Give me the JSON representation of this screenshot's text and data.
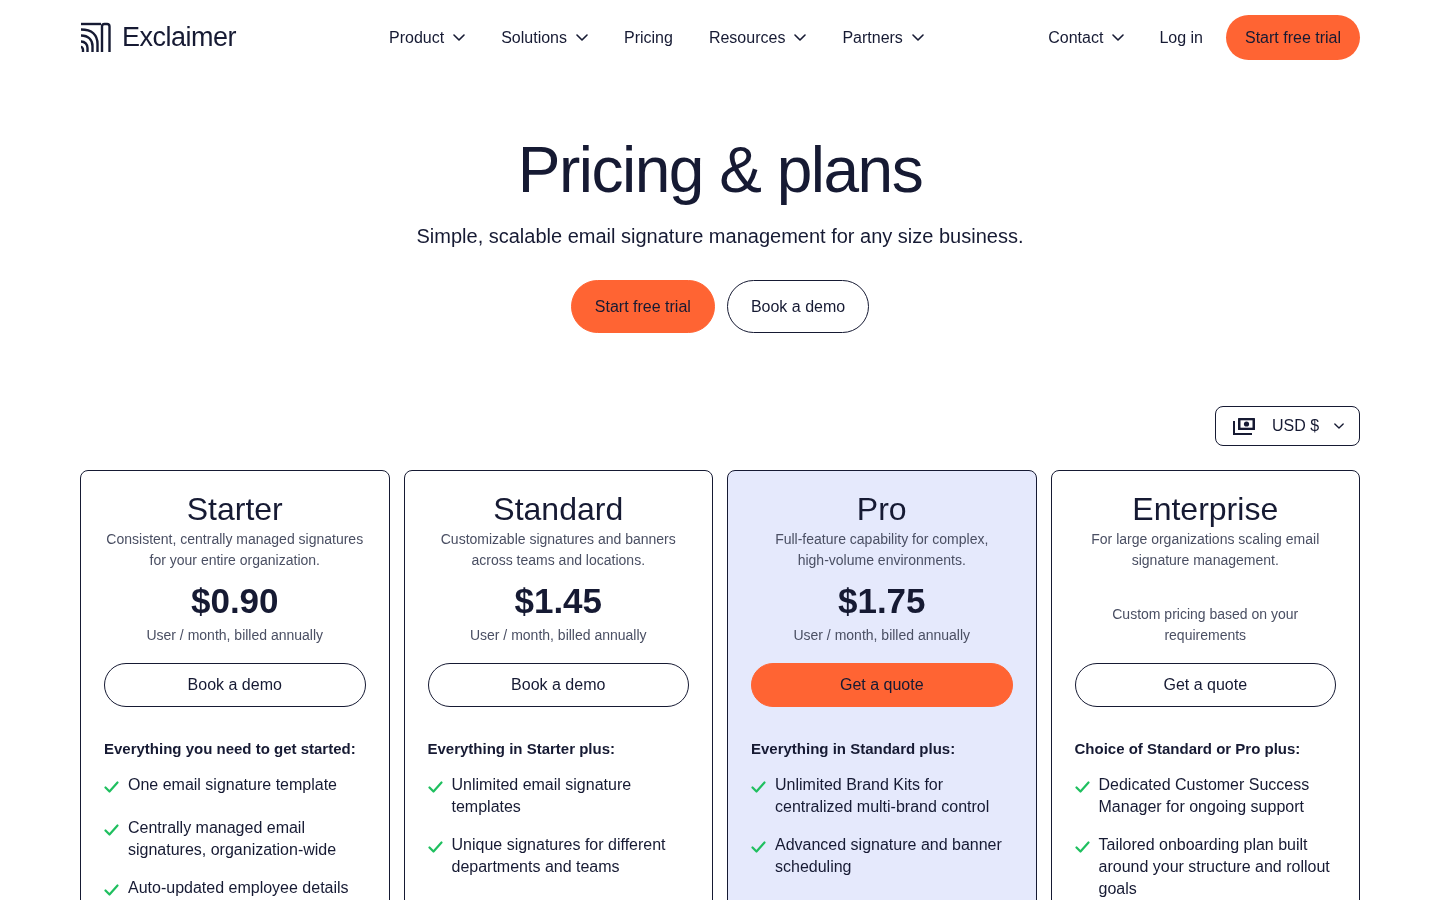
{
  "header": {
    "logo": {
      "text": "Exclaimer"
    },
    "nav": [
      {
        "label": "Product",
        "dropdown": true
      },
      {
        "label": "Solutions",
        "dropdown": true
      },
      {
        "label": "Pricing",
        "dropdown": false
      },
      {
        "label": "Resources",
        "dropdown": true
      },
      {
        "label": "Partners",
        "dropdown": true
      }
    ],
    "secondary_nav": [
      {
        "label": "Contact",
        "dropdown": true
      },
      {
        "label": "Log in",
        "dropdown": false
      }
    ],
    "cta": {
      "label": "Start free trial"
    }
  },
  "hero": {
    "title": "Pricing & plans",
    "subtitle": "Simple, scalable email signature management for any size business.",
    "buttons": [
      {
        "label": "Start free trial",
        "kind": "primary"
      },
      {
        "label": "Book a demo",
        "kind": "outline"
      }
    ]
  },
  "currency": {
    "label": "USD $"
  },
  "plans": [
    {
      "name": "Starter",
      "description": [
        "Consistent, centrally managed signatures",
        "for your entire organization."
      ],
      "featured": false,
      "price": "$0.90",
      "billing": "User / month, billed annually",
      "button": {
        "label": "Book a demo"
      },
      "features_heading": "Everything you need to get started:",
      "features": [
        "One email signature template",
        "Centrally managed email signatures, organization-wide",
        "Auto-updated employee details"
      ]
    },
    {
      "name": "Standard",
      "description": [
        "Customizable signatures and banners",
        "across teams and locations."
      ],
      "featured": false,
      "price": "$1.45",
      "billing": "User / month, billed annually",
      "button": {
        "label": "Book a demo"
      },
      "features_heading": "Everything in Starter plus:",
      "features": [
        "Unlimited email signature templates",
        "Unique signatures for different departments and teams"
      ]
    },
    {
      "name": "Pro",
      "description": [
        "Full-feature capability for complex,",
        "high-volume environments."
      ],
      "featured": true,
      "price": "$1.75",
      "billing": "User / month, billed annually",
      "button": {
        "label": "Get a quote"
      },
      "features_heading": "Everything in Standard plus:",
      "features": [
        "Unlimited Brand Kits for centralized multi-brand control",
        "Advanced signature and banner scheduling"
      ]
    },
    {
      "name": "Enterprise",
      "description": [
        "For large organizations scaling email",
        "signature management."
      ],
      "featured": false,
      "pricing_note": "Custom pricing based on your requirements",
      "button": {
        "label": "Get a quote"
      },
      "features_heading": "Choice of Standard or Pro plus:",
      "features": [
        "Dedicated Customer Success Manager for ongoing support",
        "Tailored onboarding plan built around your structure and rollout goals"
      ]
    }
  ]
}
